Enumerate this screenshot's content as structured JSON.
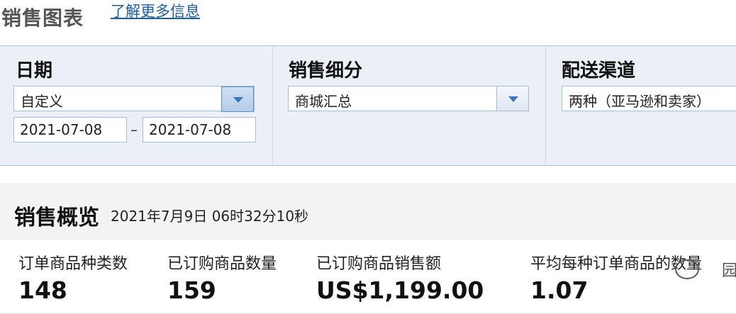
{
  "header": {
    "title": "销售图表",
    "learn_more": "了解更多信息"
  },
  "filters": {
    "date": {
      "label": "日期",
      "selected": "自定义",
      "start": "2021-07-08",
      "separator": "–",
      "end": "2021-07-08"
    },
    "segment": {
      "label": "销售细分",
      "selected": "商城汇总"
    },
    "channel": {
      "label": "配送渠道",
      "selected": "两种（亚马逊和卖家）"
    }
  },
  "overview": {
    "title": "销售概览",
    "timestamp": "2021年7月9日 06时32分10秒",
    "stats": [
      {
        "label": "订单商品种类数",
        "value": "148"
      },
      {
        "label": "已订购商品数量",
        "value": "159"
      },
      {
        "label": "已订购商品销售额",
        "value": "US$1,199.00"
      },
      {
        "label": "平均每种订单商品的数量",
        "value": "1.07"
      }
    ]
  },
  "watermark": {
    "text": "园"
  },
  "colors": {
    "link": "#1a5fa8",
    "panel_bg": "#eaf0f6",
    "accent": "#3a76b8"
  }
}
